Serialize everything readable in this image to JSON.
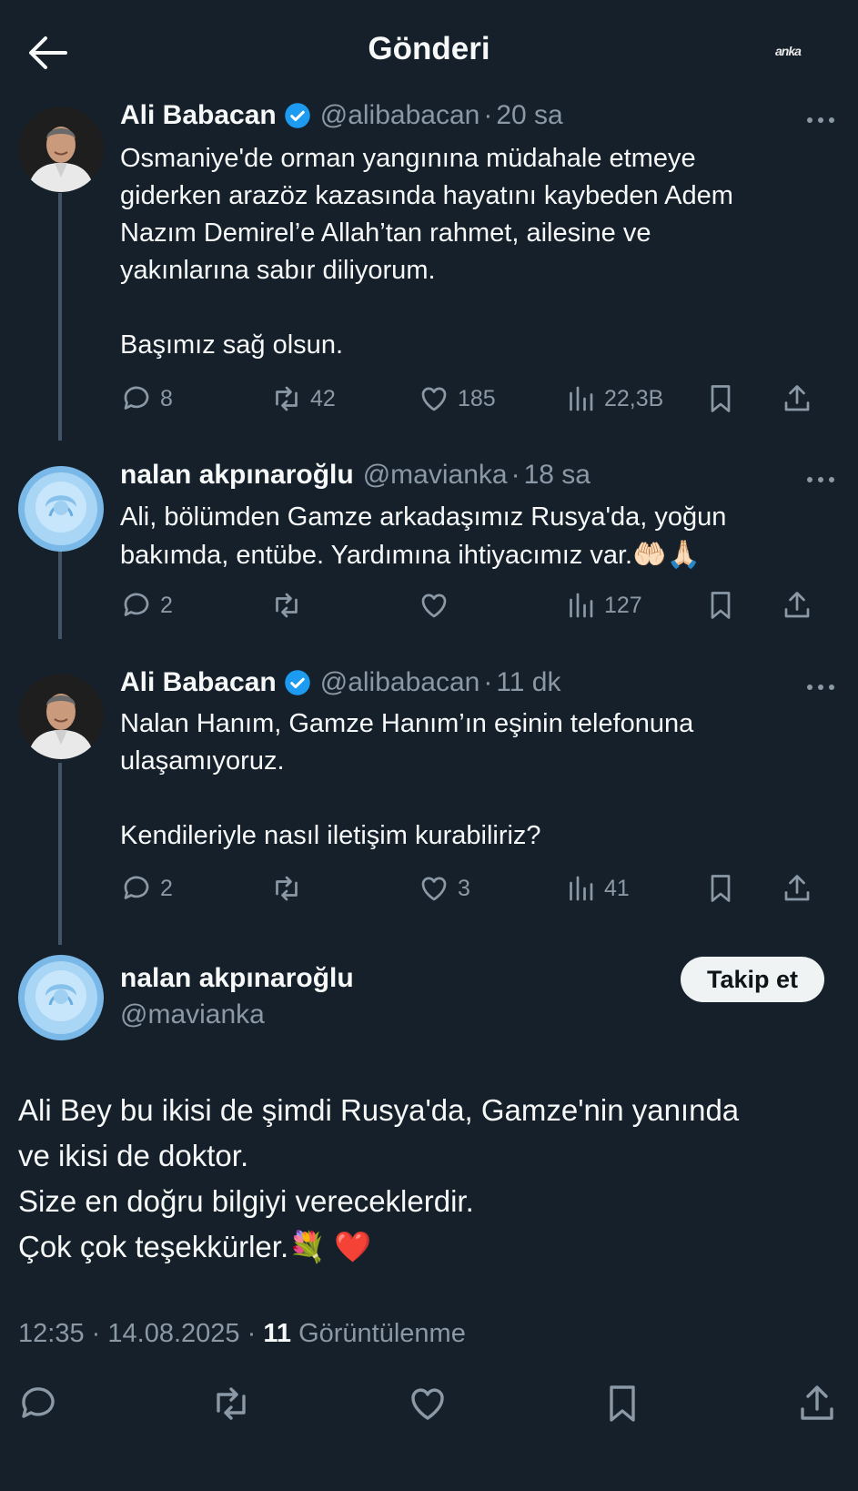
{
  "header": {
    "title": "Gönderi",
    "watermark": "anka"
  },
  "tweets": [
    {
      "name": "Ali Babacan",
      "handle": "@alibabacan",
      "time": "20 sa",
      "lines": [
        "Osmaniye'de orman yangınına müdahale etmeye",
        "giderken arazöz kazasında hayatını kaybeden Adem",
        "Nazım Demirel’e Allah’tan rahmet, ailesine ve",
        "yakınlarına sabır diliyorum.",
        "",
        "Başımız sağ olsun."
      ],
      "replies": "8",
      "retweets": "42",
      "likes": "185",
      "views": "22,3B"
    },
    {
      "name": "nalan akpınaroğlu",
      "handle": "@mavianka",
      "time": "18 sa",
      "line1": "Ali, bölümden Gamze arkadaşımız Rusya'da, yoğun",
      "line2": "bakımda, entübe. Yardımına ihtiyacımız var.",
      "line2_emoji": "🤲🏻🙏🏻",
      "replies": "2",
      "retweets": "",
      "likes": "",
      "views": "127"
    },
    {
      "name": "Ali Babacan",
      "handle": "@alibabacan",
      "time": "11 dk",
      "lines": [
        "Nalan Hanım, Gamze Hanım’ın eşinin telefonuna",
        "ulaşamıyoruz.",
        "",
        "Kendileriyle nasıl iletişim kurabiliriz?"
      ],
      "replies": "2",
      "retweets": "",
      "likes": "3",
      "views": "41"
    }
  ],
  "main_tweet": {
    "name": "nalan akpınaroğlu",
    "handle": "@mavianka",
    "follow_label": "Takip et",
    "lines": [
      "Ali Bey bu ikisi de şimdi Rusya'da, Gamze'nin yanında",
      "ve ikisi de doktor.",
      "Size en doğru bilgiyi vereceklerdir."
    ],
    "last_line": "Çok çok teşekkürler.",
    "last_line_emoji": "💐 ❤️",
    "time": "12:35",
    "date": "14.08.2025",
    "views_count": "11",
    "views_label": "Görüntülenme"
  },
  "colors": {
    "background": "#15202b",
    "muted": "#8b98a5",
    "verified": "#1d9bf0",
    "thread_line": "#425466"
  }
}
